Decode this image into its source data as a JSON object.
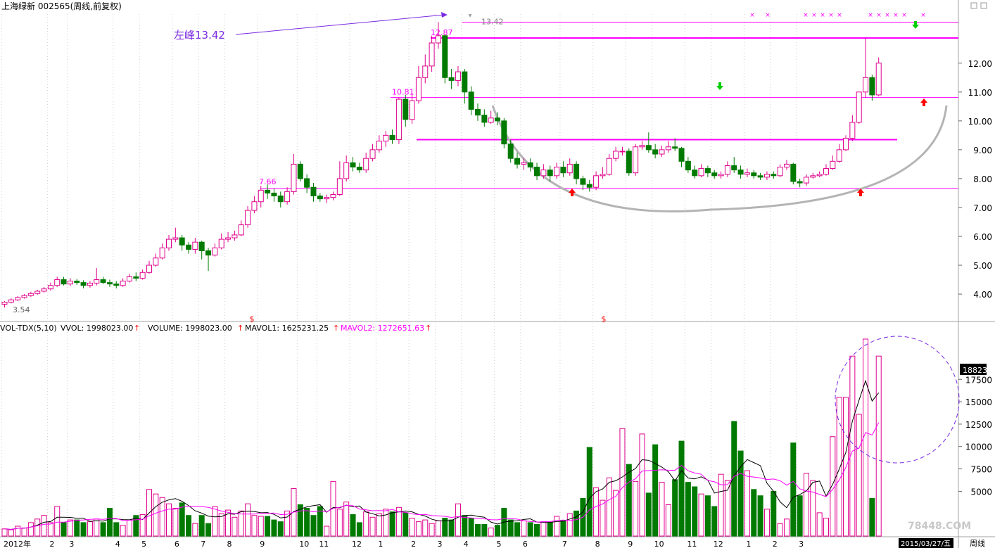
{
  "header": {
    "title": "上海绿新 002565(周线,前复权)"
  },
  "annotations": {
    "left_peak": "左峰13.42",
    "label_high": "13.42",
    "label_12_87": "12.87",
    "label_10_81": "10.81",
    "label_7_66": "7.66",
    "label_low": "3.54",
    "dollar": "$"
  },
  "volume_header": {
    "indicator": "VOL-TDX(5,10)",
    "vvol": "VVOL: 1998023.00",
    "volume": "VOLUME: 1998023.00",
    "mavol1": "MAVOL1: 1625231.25",
    "mavol2": "MAVOL2: 1272651.63"
  },
  "right_panel": {
    "current_vol_box": "18823",
    "period": "周线"
  },
  "date_box": "2015/03/27/五",
  "watermark": "78448.COM",
  "colors": {
    "up": "#e0008c",
    "down": "#007a00",
    "magenta_line": "#ff00ff",
    "purple": "#7b2be0",
    "arc": "#b4b4b4",
    "red_arrow": "#ff0000",
    "green_arrow": "#00cc00"
  },
  "chart_data": [
    {
      "type": "candlestick",
      "ylim": [
        3.1,
        13.7
      ],
      "yticks": [
        4,
        5,
        6,
        7,
        8,
        9,
        10,
        11,
        12
      ],
      "ytick_labels": [
        "4.00",
        "5.00",
        "6.00",
        "7.00",
        "8.00",
        "9.00",
        "10.00",
        "11.00",
        "12.00"
      ],
      "x_labels": [
        "2012年",
        "2",
        "3",
        "4",
        "5",
        "6",
        "7",
        "8",
        "9",
        "10",
        "11",
        "12",
        "1",
        "2",
        "3",
        "4",
        "5",
        "6",
        "7",
        "8",
        "9",
        "10",
        "11",
        "12",
        "1",
        "2",
        "3"
      ],
      "x_label_week_index": [
        0,
        7,
        10,
        17,
        21,
        26,
        30,
        34,
        39,
        45,
        48,
        53,
        57,
        62,
        66,
        70,
        75,
        79,
        85,
        90,
        95,
        99,
        104,
        108,
        113,
        117,
        121
      ],
      "horizontal_levels": [
        13.42,
        12.87,
        10.81,
        9.35,
        7.66
      ],
      "candles": [
        [
          3.65,
          3.72,
          3.54,
          3.76
        ],
        [
          3.72,
          3.8,
          3.68,
          3.85
        ],
        [
          3.8,
          3.88,
          3.76,
          3.93
        ],
        [
          3.88,
          3.95,
          3.84,
          4.0
        ],
        [
          3.95,
          4.02,
          3.9,
          4.08
        ],
        [
          4.02,
          4.1,
          3.98,
          4.15
        ],
        [
          4.1,
          4.18,
          4.05,
          4.25
        ],
        [
          4.18,
          4.3,
          4.12,
          4.4
        ],
        [
          4.3,
          4.5,
          4.25,
          4.6
        ],
        [
          4.5,
          4.35,
          4.3,
          4.6
        ],
        [
          4.35,
          4.45,
          4.28,
          4.55
        ],
        [
          4.45,
          4.4,
          4.32,
          4.52
        ],
        [
          4.4,
          4.3,
          4.2,
          4.48
        ],
        [
          4.3,
          4.38,
          4.22,
          4.45
        ],
        [
          4.38,
          4.5,
          4.3,
          4.9
        ],
        [
          4.5,
          4.4,
          4.35,
          4.6
        ],
        [
          4.4,
          4.35,
          4.25,
          4.5
        ],
        [
          4.35,
          4.3,
          4.2,
          4.45
        ],
        [
          4.3,
          4.45,
          4.25,
          4.55
        ],
        [
          4.45,
          4.6,
          4.4,
          4.7
        ],
        [
          4.6,
          4.55,
          4.45,
          4.75
        ],
        [
          4.55,
          4.75,
          4.5,
          4.85
        ],
        [
          4.75,
          5.0,
          4.7,
          5.15
        ],
        [
          5.0,
          5.25,
          4.95,
          5.4
        ],
        [
          5.25,
          5.6,
          5.2,
          5.75
        ],
        [
          5.6,
          5.9,
          5.5,
          6.05
        ],
        [
          5.9,
          5.95,
          5.8,
          6.3
        ],
        [
          5.95,
          5.7,
          5.5,
          6.05
        ],
        [
          5.7,
          5.55,
          5.4,
          5.8
        ],
        [
          5.55,
          5.8,
          5.4,
          5.95
        ],
        [
          5.8,
          5.5,
          5.2,
          5.85
        ],
        [
          5.5,
          5.35,
          4.8,
          5.6
        ],
        [
          5.35,
          5.6,
          5.3,
          5.75
        ],
        [
          5.6,
          5.9,
          5.55,
          6.1
        ],
        [
          5.9,
          5.95,
          5.8,
          6.15
        ],
        [
          5.95,
          6.05,
          5.85,
          6.2
        ],
        [
          6.05,
          6.4,
          6.0,
          6.55
        ],
        [
          6.4,
          6.9,
          6.3,
          7.05
        ],
        [
          6.9,
          7.2,
          6.8,
          7.4
        ],
        [
          7.2,
          7.6,
          7.0,
          7.75
        ],
        [
          7.6,
          7.5,
          7.3,
          7.8
        ],
        [
          7.5,
          7.4,
          7.2,
          7.65
        ],
        [
          7.4,
          7.2,
          7.0,
          7.55
        ],
        [
          7.2,
          7.55,
          7.1,
          7.7
        ],
        [
          7.55,
          8.5,
          7.45,
          8.85
        ],
        [
          8.5,
          8.0,
          7.9,
          8.6
        ],
        [
          8.0,
          7.7,
          7.5,
          8.15
        ],
        [
          7.7,
          7.4,
          7.2,
          7.85
        ],
        [
          7.4,
          7.3,
          7.2,
          7.5
        ],
        [
          7.3,
          7.35,
          7.15,
          7.45
        ],
        [
          7.35,
          7.45,
          7.25,
          7.55
        ],
        [
          7.45,
          8.0,
          7.4,
          8.6
        ],
        [
          8.0,
          8.55,
          7.9,
          8.8
        ],
        [
          8.55,
          8.4,
          8.25,
          8.75
        ],
        [
          8.4,
          8.3,
          8.2,
          8.55
        ],
        [
          8.3,
          8.7,
          8.2,
          8.9
        ],
        [
          8.7,
          9.0,
          8.6,
          9.2
        ],
        [
          9.0,
          9.3,
          8.9,
          9.5
        ],
        [
          9.3,
          9.5,
          9.1,
          9.65
        ],
        [
          9.5,
          9.35,
          9.2,
          9.7
        ],
        [
          9.35,
          10.75,
          9.2,
          10.8
        ],
        [
          10.75,
          10.05,
          9.8,
          10.9
        ],
        [
          10.05,
          10.7,
          9.9,
          10.95
        ],
        [
          10.7,
          11.5,
          10.6,
          11.9
        ],
        [
          11.5,
          11.9,
          11.3,
          12.3
        ],
        [
          11.9,
          12.7,
          11.7,
          12.95
        ],
        [
          12.7,
          12.95,
          12.5,
          13.42
        ],
        [
          12.95,
          11.5,
          11.3,
          13.0
        ],
        [
          11.5,
          11.4,
          11.1,
          11.8
        ],
        [
          11.4,
          11.7,
          11.2,
          11.9
        ],
        [
          11.7,
          11.0,
          10.6,
          11.8
        ],
        [
          11.0,
          10.4,
          10.2,
          11.2
        ],
        [
          10.4,
          10.2,
          10.0,
          10.6
        ],
        [
          10.2,
          9.95,
          9.8,
          10.4
        ],
        [
          9.95,
          10.1,
          9.9,
          10.35
        ],
        [
          10.1,
          10.0,
          9.85,
          10.3
        ],
        [
          10.0,
          9.2,
          9.05,
          10.1
        ],
        [
          9.2,
          8.7,
          8.55,
          9.35
        ],
        [
          8.7,
          8.5,
          8.35,
          8.9
        ],
        [
          8.5,
          8.55,
          8.3,
          8.7
        ],
        [
          8.55,
          8.4,
          8.25,
          8.7
        ],
        [
          8.4,
          8.1,
          7.95,
          8.55
        ],
        [
          8.1,
          8.3,
          8.0,
          8.5
        ],
        [
          8.3,
          8.1,
          7.9,
          8.45
        ],
        [
          8.1,
          8.4,
          8.0,
          8.55
        ],
        [
          8.4,
          8.2,
          8.05,
          8.6
        ],
        [
          8.2,
          8.5,
          8.1,
          8.7
        ],
        [
          8.5,
          8.0,
          7.8,
          8.6
        ],
        [
          8.0,
          7.8,
          7.6,
          8.1
        ],
        [
          7.8,
          7.7,
          7.55,
          7.95
        ],
        [
          7.7,
          8.1,
          7.6,
          8.25
        ],
        [
          8.1,
          8.15,
          8.0,
          8.4
        ],
        [
          8.15,
          8.7,
          8.1,
          8.85
        ],
        [
          8.7,
          8.95,
          8.6,
          9.1
        ],
        [
          8.95,
          8.95,
          8.8,
          9.1
        ],
        [
          8.95,
          8.2,
          8.1,
          9.05
        ],
        [
          8.2,
          9.1,
          8.1,
          9.2
        ],
        [
          9.1,
          9.15,
          9.0,
          9.3
        ],
        [
          9.15,
          9.0,
          8.9,
          9.6
        ],
        [
          9.0,
          8.85,
          8.7,
          9.2
        ],
        [
          8.85,
          9.0,
          8.75,
          9.15
        ],
        [
          9.0,
          9.1,
          8.9,
          9.3
        ],
        [
          9.1,
          9.05,
          8.95,
          9.4
        ],
        [
          9.05,
          8.6,
          8.4,
          9.1
        ],
        [
          8.6,
          8.3,
          8.2,
          8.75
        ],
        [
          8.3,
          8.1,
          8.0,
          8.45
        ],
        [
          8.1,
          8.35,
          8.05,
          8.5
        ],
        [
          8.35,
          8.2,
          8.05,
          8.45
        ],
        [
          8.2,
          8.1,
          8.0,
          8.3
        ],
        [
          8.1,
          8.15,
          8.0,
          8.25
        ],
        [
          8.15,
          8.45,
          8.05,
          8.6
        ],
        [
          8.45,
          8.3,
          8.2,
          8.75
        ],
        [
          8.3,
          8.15,
          8.0,
          8.45
        ],
        [
          8.15,
          8.2,
          8.05,
          8.35
        ],
        [
          8.2,
          8.1,
          8.0,
          8.3
        ],
        [
          8.1,
          8.05,
          7.95,
          8.2
        ],
        [
          8.05,
          8.15,
          7.95,
          8.25
        ],
        [
          8.15,
          8.1,
          8.0,
          8.25
        ],
        [
          8.1,
          8.4,
          8.05,
          8.5
        ],
        [
          8.4,
          8.5,
          8.3,
          8.65
        ],
        [
          8.5,
          7.9,
          7.8,
          8.55
        ],
        [
          7.9,
          7.85,
          7.7,
          8.0
        ],
        [
          7.85,
          8.05,
          7.75,
          8.15
        ],
        [
          8.05,
          8.1,
          8.0,
          8.2
        ],
        [
          8.1,
          8.15,
          8.05,
          8.25
        ],
        [
          8.15,
          8.35,
          8.1,
          8.5
        ],
        [
          8.35,
          8.6,
          8.3,
          8.8
        ],
        [
          8.6,
          9.0,
          8.55,
          9.2
        ],
        [
          9.0,
          9.4,
          8.95,
          9.5
        ],
        [
          9.4,
          9.95,
          9.3,
          10.2
        ],
        [
          9.95,
          11.0,
          9.9,
          11.0
        ],
        [
          11.0,
          11.5,
          10.8,
          12.87
        ],
        [
          11.5,
          10.9,
          10.7,
          11.6
        ],
        [
          10.9,
          12.0,
          10.85,
          12.2
        ]
      ]
    },
    {
      "type": "bar",
      "ylim": [
        0,
        22000
      ],
      "yticks": [
        5000,
        7500,
        10000,
        12500,
        15000,
        17500
      ],
      "ytick_labels": [
        "5000",
        "7500",
        "10000",
        "12500",
        "15000",
        "17500"
      ],
      "series": [
        {
          "name": "VOLUME",
          "values": [
            800,
            700,
            1100,
            900,
            1500,
            1900,
            2300,
            1500,
            3300,
            1500,
            1800,
            1800,
            1500,
            1600,
            1900,
            1500,
            3100,
            1500,
            1200,
            1800,
            2300,
            2400,
            5200,
            4700,
            4300,
            3600,
            3100,
            3700,
            2300,
            1400,
            2300,
            1400,
            3300,
            2500,
            2900,
            2100,
            2800,
            3600,
            2300,
            2200,
            2200,
            1800,
            1600,
            2800,
            5300,
            3500,
            3100,
            2300,
            3300,
            1100,
            6100,
            3000,
            3800,
            2400,
            1500,
            2700,
            2100,
            2500,
            3000,
            2700,
            3200,
            2600,
            2000,
            1600,
            1800,
            1400,
            1700,
            2000,
            1800,
            3600,
            2300,
            2000,
            1300,
            1300,
            900,
            1200,
            3100,
            1800,
            1500,
            1700,
            1500,
            1300,
            1600,
            1500,
            2200,
            1700,
            2500,
            2800,
            4200,
            9900,
            5400,
            4000,
            6500,
            5100,
            12000,
            8000,
            6100,
            11400,
            4800,
            10200,
            6000,
            3500,
            6300,
            10600,
            6000,
            5500,
            4700,
            4500,
            3300,
            6900,
            6200,
            12800,
            9500,
            7300,
            5200,
            4500,
            3000,
            5000,
            1400,
            1900,
            10400,
            4500,
            7000,
            6200,
            2600,
            2000,
            11100,
            15500,
            15500,
            20100,
            13600,
            22000,
            4200,
            20100
          ]
        }
      ]
    }
  ]
}
